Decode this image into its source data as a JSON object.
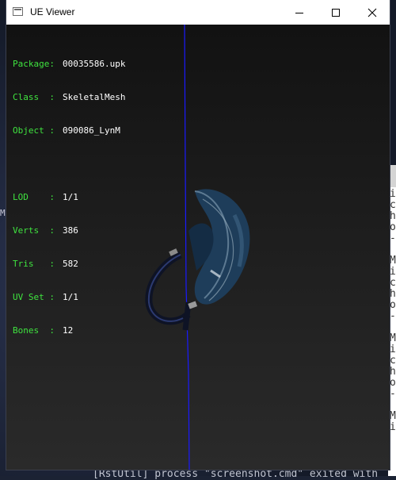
{
  "window": {
    "title": "UE Viewer",
    "controls": {
      "minimize": "minimize",
      "maximize": "maximize",
      "close": "close"
    }
  },
  "info": {
    "package": {
      "label": "Package:",
      "value": "00035586.upk"
    },
    "class": {
      "label": "Class  :",
      "value": "SkeletalMesh"
    },
    "object": {
      "label": "Object :",
      "value": "090086_LynM"
    },
    "lod": {
      "label": "LOD    :",
      "value": "1/1"
    },
    "verts": {
      "label": "Verts  :",
      "value": "386"
    },
    "tris": {
      "label": "Tris   :",
      "value": "582"
    },
    "uvset": {
      "label": "UV Set :",
      "value": "1/1"
    },
    "bones": {
      "label": "Bones  :",
      "value": "12"
    }
  },
  "background": {
    "left_char": "M",
    "console_lines": "i\nc\nh\no\n-\n\nM\ni\nc\nh\no\n-\n\nM\ni\nc\nh\no\n-\n\nM\ni",
    "bottom_text": "[RstUtil] process \"screenshot.cmd\" exited with"
  },
  "colors": {
    "info_label": "#3fe33f",
    "info_value": "#ffffff",
    "axis_line": "#1a1aff"
  }
}
